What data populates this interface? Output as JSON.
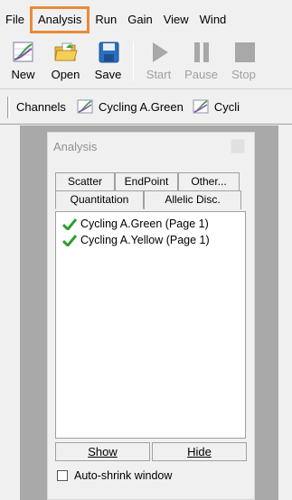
{
  "menubar": {
    "items": [
      {
        "label": "File"
      },
      {
        "label": "Analysis",
        "highlighted": true
      },
      {
        "label": "Run"
      },
      {
        "label": "Gain"
      },
      {
        "label": "View"
      },
      {
        "label": "Wind"
      }
    ],
    "highlight_color": "#e98a3a"
  },
  "toolbar": {
    "new_label": "New",
    "open_label": "Open",
    "save_label": "Save",
    "start_label": "Start",
    "pause_label": "Pause",
    "stop_label": "Stop"
  },
  "channels": {
    "label": "Channels",
    "items": [
      {
        "label": "Cycling A.Green"
      },
      {
        "label": "Cycli"
      }
    ]
  },
  "analysis_panel": {
    "title": "Analysis",
    "tabs_row1": [
      "Scatter",
      "EndPoint",
      "Other..."
    ],
    "tabs_row2": [
      "Quantitation",
      "Allelic Disc."
    ],
    "list_items": [
      {
        "label": "Cycling A.Green (Page 1)"
      },
      {
        "label": "Cycling A.Yellow (Page 1)"
      }
    ],
    "show_label": "Show",
    "hide_label": "Hide",
    "autoshrink_label": "Auto-shrink window",
    "autoshrink_checked": false
  },
  "colors": {
    "check": "#2e9e2e",
    "workspace": "#a9a9a9"
  }
}
